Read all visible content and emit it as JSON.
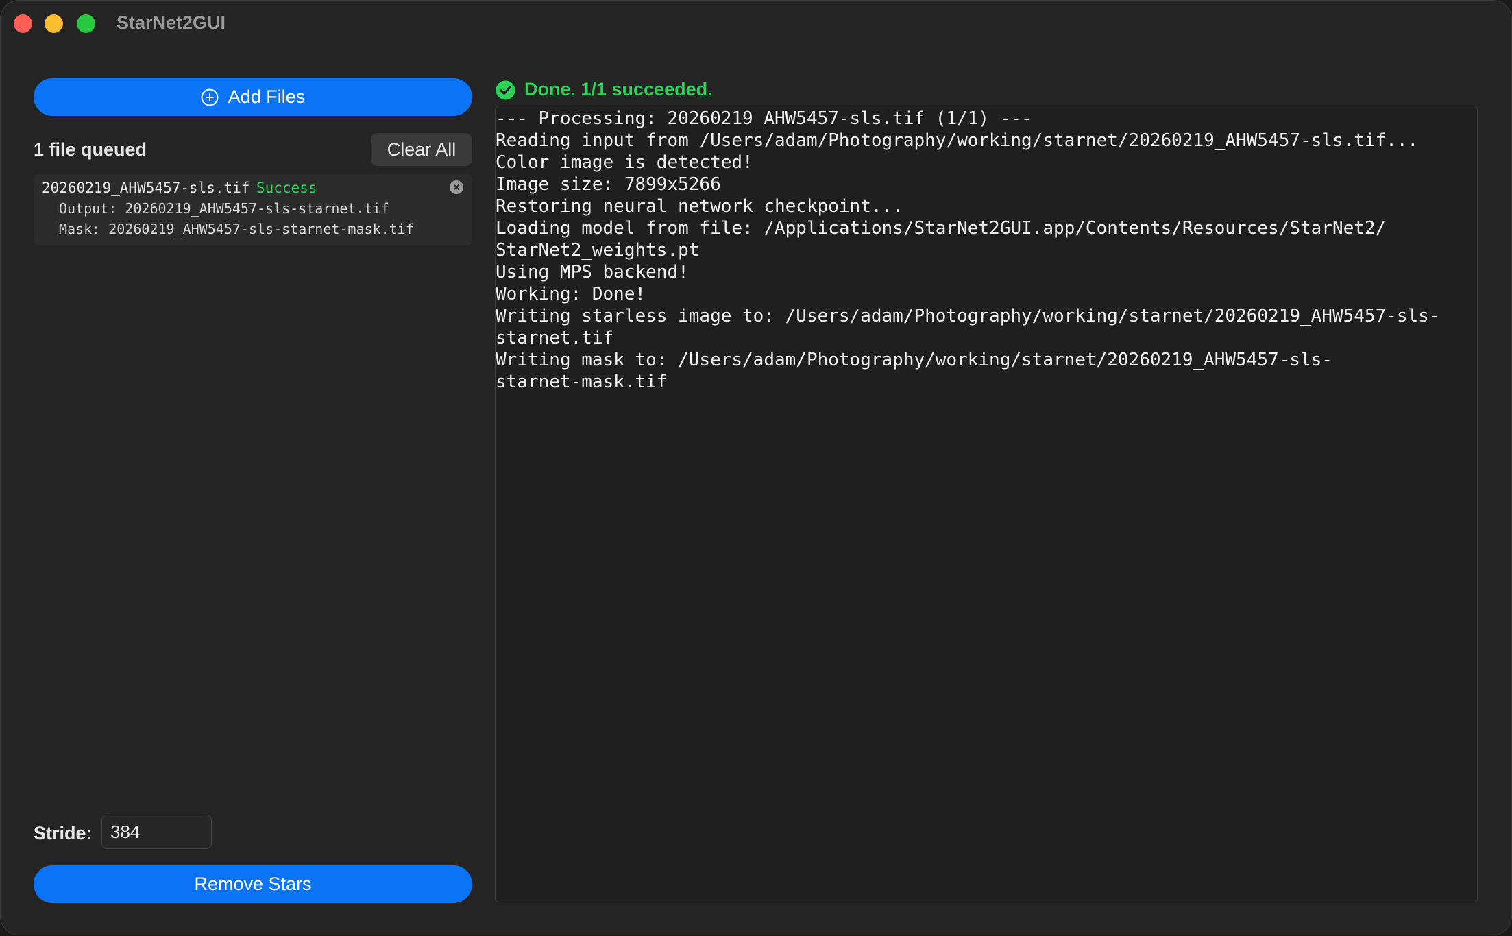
{
  "window": {
    "title": "StarNet2GUI"
  },
  "sidebar": {
    "add_files_label": "Add Files",
    "queued_label": "1 file queued",
    "clear_all_label": "Clear All",
    "files": [
      {
        "name": "20260219_AHW5457-sls.tif",
        "status": "Success",
        "output": "Output: 20260219_AHW5457-sls-starnet.tif",
        "mask": "Mask: 20260219_AHW5457-sls-starnet-mask.tif"
      }
    ],
    "stride_label": "Stride:",
    "stride_value": "384",
    "remove_stars_label": "Remove Stars"
  },
  "status": {
    "text": "Done. 1/1 succeeded.",
    "icon": "checkmark-circle-icon",
    "color": "#30d158"
  },
  "log": {
    "lines": [
      "--- Processing: 20260219_AHW5457-sls.tif (1/1) ---",
      "Reading input from /Users/adam/Photography/working/starnet/20260219_AHW5457-sls.tif...",
      "Color image is detected!",
      "Image size: 7899x5266",
      "Restoring neural network checkpoint...",
      "Loading model from file: /Applications/StarNet2GUI.app/Contents/Resources/StarNet2/",
      "StarNet2_weights.pt",
      "Using MPS backend!",
      "Working: Done!",
      "Writing starless image to: /Users/adam/Photography/working/starnet/20260219_AHW5457-sls-",
      "starnet.tif",
      "Writing mask to: /Users/adam/Photography/working/starnet/20260219_AHW5457-sls-",
      "starnet-mask.tif"
    ]
  },
  "colors": {
    "accent": "#0a73f6",
    "success": "#30d158",
    "window_bg": "#242424"
  }
}
